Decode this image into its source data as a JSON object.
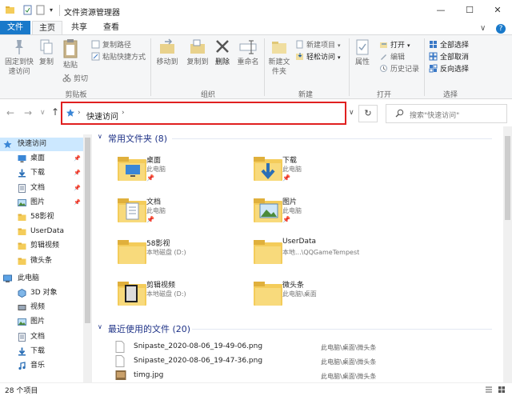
{
  "window": {
    "title": "文件资源管理器",
    "controls": {
      "minimize": "—",
      "maximize": "☐",
      "close": "✕"
    }
  },
  "tabs": {
    "file": "文件",
    "home": "主页",
    "share": "共享",
    "view": "查看",
    "collapse": "∨",
    "help": "?"
  },
  "ribbon": {
    "clipboard": {
      "pin_quick": "固定到快速访问",
      "copy": "复制",
      "paste": "粘贴",
      "copy_path": "复制路径",
      "paste_shortcut": "粘贴快捷方式",
      "cut": "剪切",
      "group_label": "剪贴板"
    },
    "organize": {
      "move_to": "移动到",
      "copy_to": "复制到",
      "delete": "删除",
      "rename": "重命名",
      "group_label": "组织"
    },
    "new": {
      "new_folder": "新建文件夹",
      "new_item": "新建项目",
      "easy_access": "轻松访问",
      "group_label": "新建"
    },
    "open": {
      "properties": "属性",
      "open": "打开",
      "edit": "编辑",
      "history": "历史记录",
      "group_label": "打开"
    },
    "select": {
      "select_all": "全部选择",
      "select_none": "全部取消",
      "invert": "反向选择",
      "group_label": "选择"
    }
  },
  "nav": {
    "back": "←",
    "forward": "→",
    "recent": "∨",
    "up": "↑",
    "address": "快速访问",
    "refresh": "↻",
    "search_placeholder": "搜索\"快速访问\""
  },
  "sidebar": {
    "items": [
      {
        "label": "快速访问",
        "icon": "star-icon",
        "selected": true,
        "pinned": false,
        "indent": 0
      },
      {
        "label": "桌面",
        "icon": "desktop-icon",
        "pinned": true,
        "indent": 1
      },
      {
        "label": "下载",
        "icon": "download-icon",
        "pinned": true,
        "indent": 1
      },
      {
        "label": "文档",
        "icon": "document-icon",
        "pinned": true,
        "indent": 1
      },
      {
        "label": "图片",
        "icon": "picture-icon",
        "pinned": true,
        "indent": 1
      },
      {
        "label": "58影视",
        "icon": "folder-icon",
        "pinned": false,
        "indent": 1
      },
      {
        "label": "UserData",
        "icon": "folder-icon",
        "pinned": false,
        "indent": 1
      },
      {
        "label": "剪辑视频",
        "icon": "folder-icon",
        "pinned": false,
        "indent": 1
      },
      {
        "label": "微头条",
        "icon": "folder-icon",
        "pinned": false,
        "indent": 1
      },
      {
        "label": "此电脑",
        "icon": "computer-icon",
        "pinned": false,
        "indent": 0
      },
      {
        "label": "3D 对象",
        "icon": "3d-objects-icon",
        "pinned": false,
        "indent": 1
      },
      {
        "label": "视频",
        "icon": "video-icon",
        "pinned": false,
        "indent": 1
      },
      {
        "label": "图片",
        "icon": "picture-icon",
        "pinned": false,
        "indent": 1
      },
      {
        "label": "文档",
        "icon": "document-icon",
        "pinned": false,
        "indent": 1
      },
      {
        "label": "下载",
        "icon": "download-icon",
        "pinned": false,
        "indent": 1
      },
      {
        "label": "音乐",
        "icon": "music-icon",
        "pinned": false,
        "indent": 1
      }
    ]
  },
  "frequent": {
    "header": "常用文件夹 (8)",
    "folders": [
      {
        "name": "桌面",
        "sub": "此电脑",
        "pinned": true,
        "icon": "desktop-folder-icon"
      },
      {
        "name": "下载",
        "sub": "此电脑",
        "pinned": true,
        "icon": "download-folder-icon"
      },
      {
        "name": "文档",
        "sub": "此电脑",
        "pinned": true,
        "icon": "document-folder-icon"
      },
      {
        "name": "图片",
        "sub": "此电脑",
        "pinned": true,
        "icon": "picture-folder-icon"
      },
      {
        "name": "58影视",
        "sub": "本地磁盘 (D:)",
        "pinned": false,
        "icon": "folder-icon"
      },
      {
        "name": "UserData",
        "sub": "本地...\\QQGameTempest",
        "pinned": false,
        "icon": "folder-icon"
      },
      {
        "name": "剪辑视频",
        "sub": "本地磁盘 (D:)",
        "pinned": false,
        "icon": "video-folder-icon"
      },
      {
        "name": "微头条",
        "sub": "此电脑\\桌面",
        "pinned": false,
        "icon": "folder-icon"
      }
    ]
  },
  "recent": {
    "header": "最近使用的文件 (20)",
    "files": [
      {
        "name": "Snipaste_2020-08-06_19-49-06.png",
        "path": "此电脑\\桌面\\微头条"
      },
      {
        "name": "Snipaste_2020-08-06_19-47-36.png",
        "path": "此电脑\\桌面\\微头条"
      },
      {
        "name": "timg.jpg",
        "path": "此电脑\\桌面\\微头条"
      }
    ]
  },
  "status": {
    "count": "28 个项目"
  },
  "colors": {
    "accent": "#1979ca",
    "selection": "#cce8ff",
    "section_header": "#1e3287",
    "highlight_border": "#e02020",
    "folder": "#f4cc5a"
  }
}
